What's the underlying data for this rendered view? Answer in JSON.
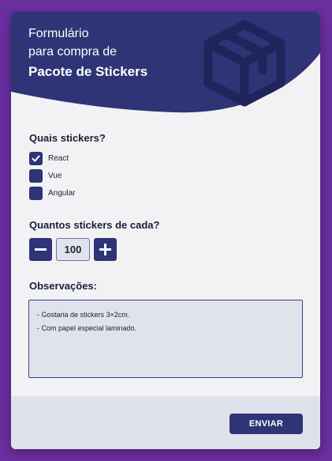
{
  "header": {
    "line1": "Formulário",
    "line2": "para compra de",
    "line3": "Pacote de Stickers"
  },
  "stickers_section": {
    "title": "Quais stickers?",
    "options": [
      {
        "label": "React",
        "checked": true
      },
      {
        "label": "Vue",
        "checked": false
      },
      {
        "label": "Angular",
        "checked": false
      }
    ]
  },
  "quantity_section": {
    "title": "Quantos stickers de cada?",
    "value": "100"
  },
  "notes_section": {
    "title": "Observações:",
    "lines": [
      "- Gostaria de stickers 3×2cm.",
      "- Com papel especial laminado."
    ]
  },
  "footer": {
    "submit_label": "ENVIAR"
  },
  "colors": {
    "background": "#6b2fa0",
    "primary": "#2e3476",
    "card": "#f2f2f4",
    "field": "#dfe3ec"
  },
  "icons": [
    "box-icon",
    "check-icon",
    "minus-icon",
    "plus-icon"
  ]
}
